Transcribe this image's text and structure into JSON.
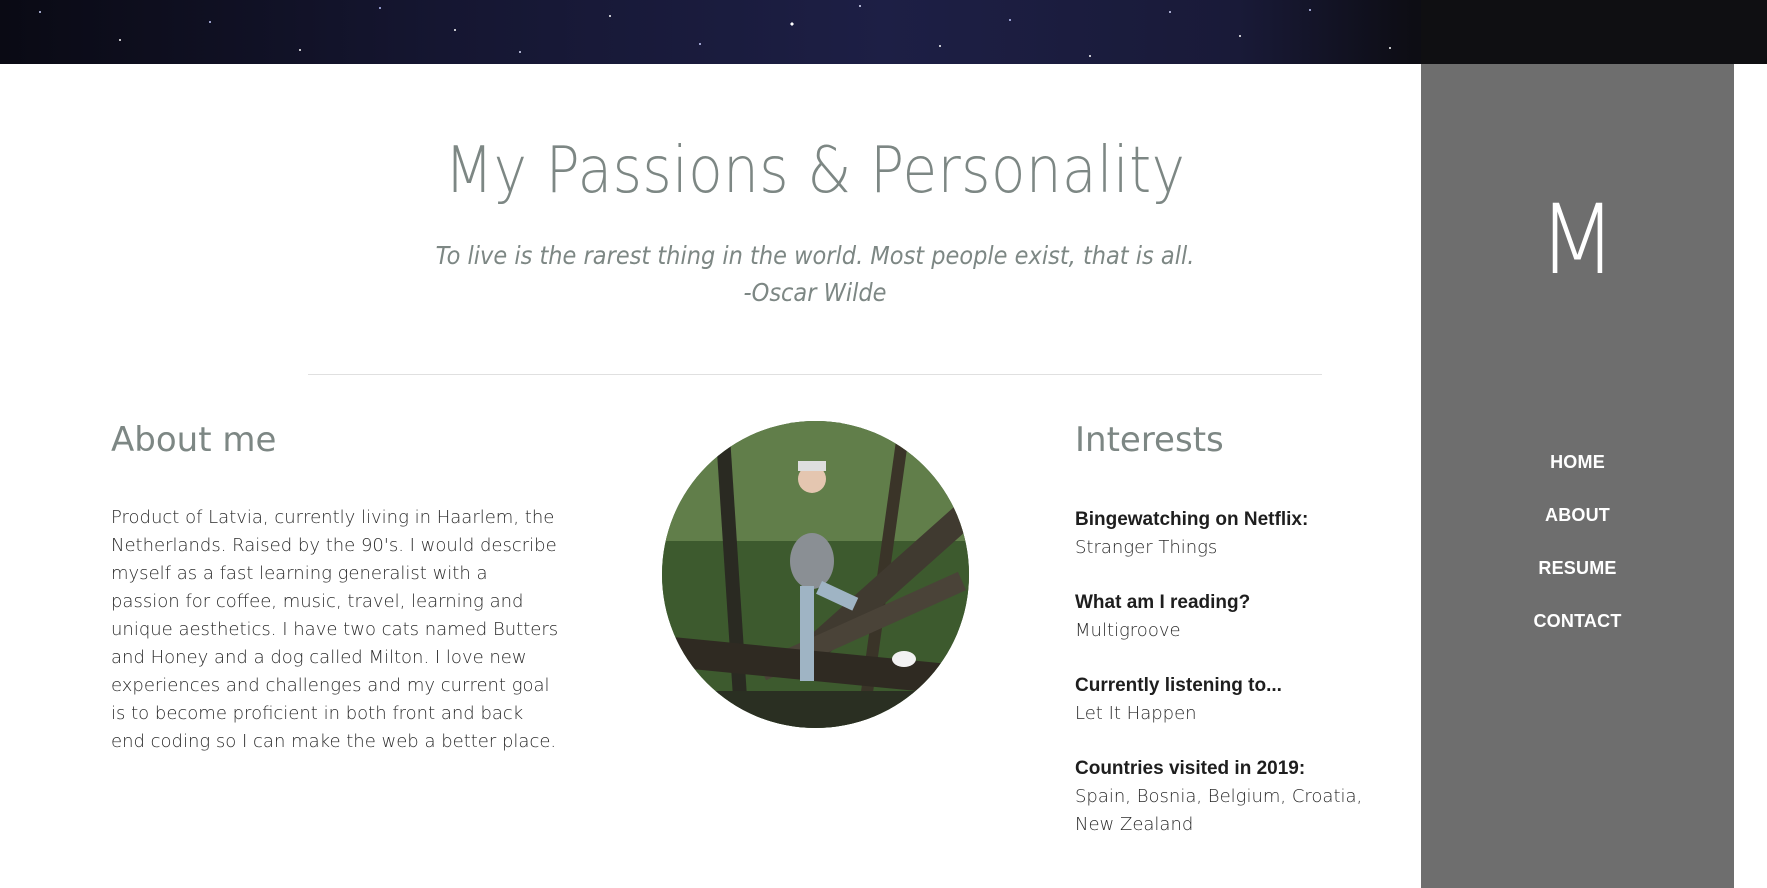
{
  "header": {
    "title": "My Passions & Personality",
    "quote_line1": "To live is the rarest thing in the world. Most people exist, that is all.",
    "quote_line2": "-Oscar Wilde"
  },
  "sidebar": {
    "logo": "M",
    "nav": [
      {
        "label": "HOME"
      },
      {
        "label": "ABOUT"
      },
      {
        "label": "RESUME"
      },
      {
        "label": "CONTACT"
      }
    ]
  },
  "about": {
    "heading": "About me",
    "text": "Product of Latvia, currently living in Haarlem, the Netherlands. Raised by the 90's. I would describe myself as a fast learning generalist with a passion for coffee, music, travel, learning and unique aesthetics. I have two cats named Butters and Honey and a dog called Milton. I love new experiences and challenges and my current goal is to become proficient in both front and back end coding so I can make the web a better place."
  },
  "interests": {
    "heading": "Interests",
    "items": [
      {
        "label": "Bingewatching on Netflix:",
        "value": "Stranger Things"
      },
      {
        "label": "What am I reading?",
        "value": "Multigroove"
      },
      {
        "label": "Currently listening to...",
        "value": "Let It Happen"
      },
      {
        "label": "Countries visited in 2019:",
        "value": "Spain, Bosnia, Belgium, Croatia, New Zealand"
      }
    ]
  },
  "colors": {
    "heading": "#7d8784",
    "sidebar_bg": "#6e6e6e",
    "banner": "#151631"
  }
}
